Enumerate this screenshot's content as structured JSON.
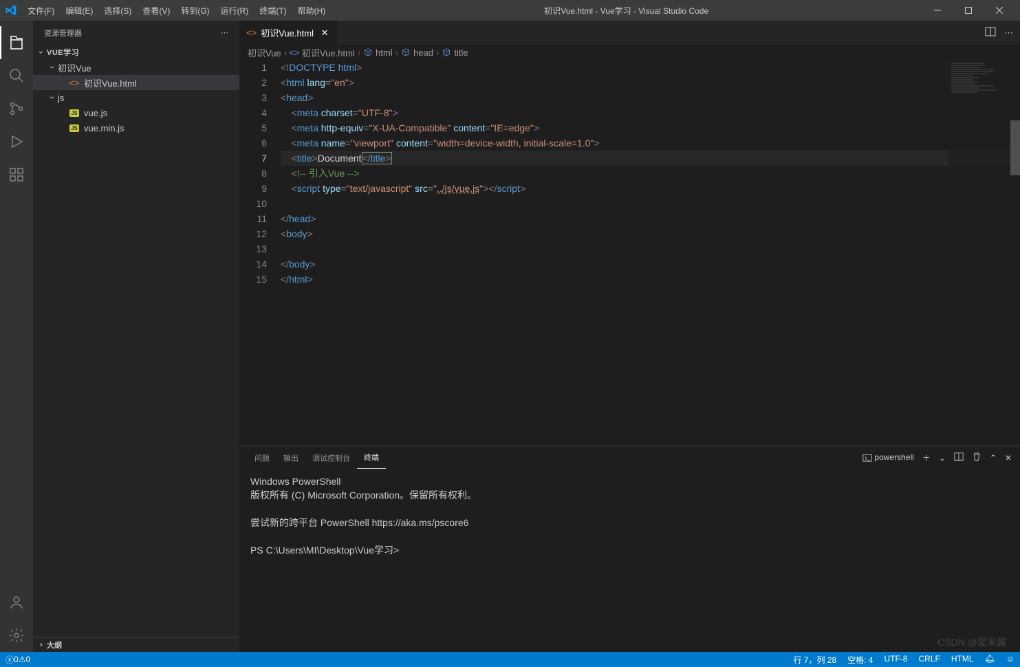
{
  "titlebar": {
    "menu": [
      "文件(F)",
      "编辑(E)",
      "选择(S)",
      "查看(V)",
      "转到(G)",
      "运行(R)",
      "终端(T)",
      "帮助(H)"
    ],
    "title": "初识Vue.html - Vue学习 - Visual Studio Code"
  },
  "sidebar": {
    "header": "资源管理器",
    "root": "VUE学习",
    "folders": [
      {
        "name": "初识Vue",
        "expanded": true,
        "files": [
          {
            "name": "初识Vue.html",
            "type": "html",
            "active": true
          }
        ]
      },
      {
        "name": "js",
        "expanded": true,
        "files": [
          {
            "name": "vue.js",
            "type": "js"
          },
          {
            "name": "vue.min.js",
            "type": "js"
          }
        ]
      }
    ],
    "outline": "大纲"
  },
  "tabs": {
    "open": [
      {
        "name": "初识Vue.html",
        "type": "html"
      }
    ]
  },
  "breadcrumbs": [
    {
      "label": "初识Vue",
      "icon": null
    },
    {
      "label": "初识Vue.html",
      "icon": "html"
    },
    {
      "label": "html",
      "icon": "cube"
    },
    {
      "label": "head",
      "icon": "cube"
    },
    {
      "label": "title",
      "icon": "cube"
    }
  ],
  "editor": {
    "activeLine": 7,
    "lines": [
      [
        {
          "t": "k-tag",
          "v": "<!"
        },
        {
          "t": "k-doctype",
          "v": "DOCTYPE"
        },
        {
          "t": "k-text",
          "v": " "
        },
        {
          "t": "k-name",
          "v": "html"
        },
        {
          "t": "k-tag",
          "v": ">"
        }
      ],
      [
        {
          "t": "k-tag",
          "v": "<"
        },
        {
          "t": "k-name",
          "v": "html"
        },
        {
          "t": "k-text",
          "v": " "
        },
        {
          "t": "k-attr",
          "v": "lang"
        },
        {
          "t": "k-tag",
          "v": "="
        },
        {
          "t": "k-str",
          "v": "\"en\""
        },
        {
          "t": "k-tag",
          "v": ">"
        }
      ],
      [
        {
          "t": "k-tag",
          "v": "<"
        },
        {
          "t": "k-name",
          "v": "head"
        },
        {
          "t": "k-tag",
          "v": ">"
        }
      ],
      [
        {
          "t": "indent",
          "v": "    "
        },
        {
          "t": "k-tag",
          "v": "<"
        },
        {
          "t": "k-name",
          "v": "meta"
        },
        {
          "t": "k-text",
          "v": " "
        },
        {
          "t": "k-attr",
          "v": "charset"
        },
        {
          "t": "k-tag",
          "v": "="
        },
        {
          "t": "k-str",
          "v": "\"UTF-8\""
        },
        {
          "t": "k-tag",
          "v": ">"
        }
      ],
      [
        {
          "t": "indent",
          "v": "    "
        },
        {
          "t": "k-tag",
          "v": "<"
        },
        {
          "t": "k-name",
          "v": "meta"
        },
        {
          "t": "k-text",
          "v": " "
        },
        {
          "t": "k-attr",
          "v": "http-equiv"
        },
        {
          "t": "k-tag",
          "v": "="
        },
        {
          "t": "k-str",
          "v": "\"X-UA-Compatible\""
        },
        {
          "t": "k-text",
          "v": " "
        },
        {
          "t": "k-attr",
          "v": "content"
        },
        {
          "t": "k-tag",
          "v": "="
        },
        {
          "t": "k-str",
          "v": "\"IE=edge\""
        },
        {
          "t": "k-tag",
          "v": ">"
        }
      ],
      [
        {
          "t": "indent",
          "v": "    "
        },
        {
          "t": "k-tag",
          "v": "<"
        },
        {
          "t": "k-name",
          "v": "meta"
        },
        {
          "t": "k-text",
          "v": " "
        },
        {
          "t": "k-attr",
          "v": "name"
        },
        {
          "t": "k-tag",
          "v": "="
        },
        {
          "t": "k-str",
          "v": "\"viewport\""
        },
        {
          "t": "k-text",
          "v": " "
        },
        {
          "t": "k-attr",
          "v": "content"
        },
        {
          "t": "k-tag",
          "v": "="
        },
        {
          "t": "k-str",
          "v": "\"width=device-width, initial-scale=1.0\""
        },
        {
          "t": "k-tag",
          "v": ">"
        }
      ],
      [
        {
          "t": "indent",
          "v": "    "
        },
        {
          "t": "k-tag",
          "v": "<"
        },
        {
          "t": "k-name",
          "v": "title"
        },
        {
          "t": "k-tag",
          "v": ">"
        },
        {
          "t": "k-text",
          "v": "Document"
        },
        {
          "t": "cursor",
          "v": "</"
        },
        {
          "t": "k-name",
          "v": "title"
        },
        {
          "t": "cursor-end",
          "v": ">"
        }
      ],
      [
        {
          "t": "indent",
          "v": "    "
        },
        {
          "t": "k-comment",
          "v": "<!-- 引入Vue -->"
        }
      ],
      [
        {
          "t": "indent",
          "v": "    "
        },
        {
          "t": "k-tag",
          "v": "<"
        },
        {
          "t": "k-name",
          "v": "script"
        },
        {
          "t": "k-text",
          "v": " "
        },
        {
          "t": "k-attr",
          "v": "type"
        },
        {
          "t": "k-tag",
          "v": "="
        },
        {
          "t": "k-str",
          "v": "\"text/javascript\""
        },
        {
          "t": "k-text",
          "v": " "
        },
        {
          "t": "k-attr",
          "v": "src"
        },
        {
          "t": "k-tag",
          "v": "="
        },
        {
          "t": "k-str",
          "v": "\""
        },
        {
          "t": "k-url",
          "v": "../js/vue.js"
        },
        {
          "t": "k-str",
          "v": "\""
        },
        {
          "t": "k-tag",
          "v": "></"
        },
        {
          "t": "k-name",
          "v": "script"
        },
        {
          "t": "k-tag",
          "v": ">"
        }
      ],
      [],
      [
        {
          "t": "k-tag",
          "v": "</"
        },
        {
          "t": "k-name",
          "v": "head"
        },
        {
          "t": "k-tag",
          "v": ">"
        }
      ],
      [
        {
          "t": "k-tag",
          "v": "<"
        },
        {
          "t": "k-name",
          "v": "body"
        },
        {
          "t": "k-tag",
          "v": ">"
        }
      ],
      [
        {
          "t": "indent",
          "v": "    "
        }
      ],
      [
        {
          "t": "k-tag",
          "v": "</"
        },
        {
          "t": "k-name",
          "v": "body"
        },
        {
          "t": "k-tag",
          "v": ">"
        }
      ],
      [
        {
          "t": "k-tag",
          "v": "</"
        },
        {
          "t": "k-name",
          "v": "html"
        },
        {
          "t": "k-tag",
          "v": ">"
        }
      ]
    ]
  },
  "panel": {
    "tabs": [
      "问题",
      "输出",
      "调试控制台",
      "终端"
    ],
    "activeTab": 3,
    "terminalName": "powershell",
    "terminalLines": [
      "Windows PowerShell",
      "版权所有 (C) Microsoft Corporation。保留所有权利。",
      "",
      "尝试新的跨平台 PowerShell https://aka.ms/pscore6",
      "",
      "PS C:\\Users\\MI\\Desktop\\Vue学习>"
    ]
  },
  "statusbar": {
    "errors": "0",
    "warnings": "0",
    "position": "行 7，列 28",
    "spaces": "空格: 4",
    "encoding": "UTF-8",
    "eol": "CRLF",
    "language": "HTML",
    "feedback": "☺"
  },
  "watermark": "CSDN @爱米酱"
}
